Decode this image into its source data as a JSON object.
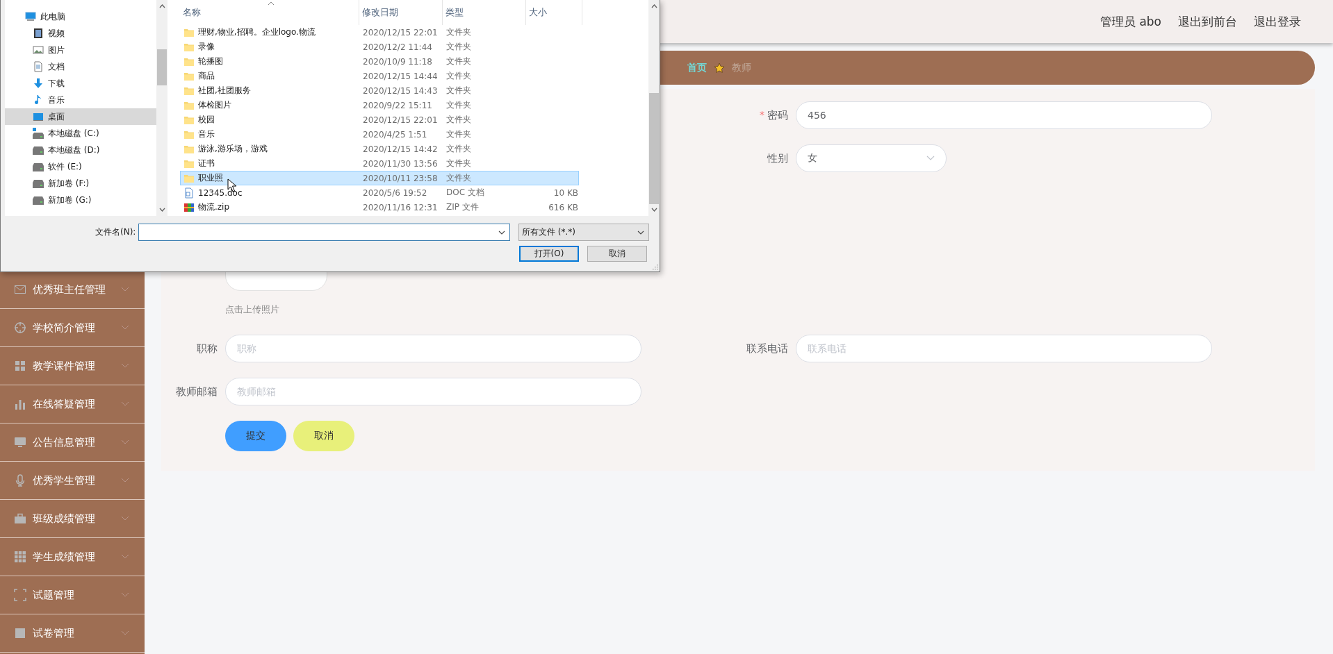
{
  "header": {
    "user": "管理员 abo",
    "links": [
      "退出到前台",
      "退出登录"
    ]
  },
  "sidebar": {
    "items": [
      {
        "label": "优秀班主任管理"
      },
      {
        "label": "学校简介管理"
      },
      {
        "label": "教学课件管理"
      },
      {
        "label": "在线答疑管理"
      },
      {
        "label": "公告信息管理"
      },
      {
        "label": "优秀学生管理"
      },
      {
        "label": "班级成绩管理"
      },
      {
        "label": "学生成绩管理"
      },
      {
        "label": "试题管理"
      },
      {
        "label": "试卷管理"
      }
    ]
  },
  "breadcrumb": [
    {
      "label": "首页",
      "current": false
    },
    {
      "label": "教师",
      "current": true
    }
  ],
  "form": {
    "rows": [
      {
        "right": {
          "kind": "text",
          "label": "密码",
          "required_mark": "*",
          "value": "456"
        }
      },
      {
        "right": {
          "kind": "select",
          "label": "性别",
          "value": "女"
        }
      },
      {
        "left": {
          "kind": "upload",
          "hint": "点击上传照片"
        }
      },
      {
        "left": {
          "kind": "text",
          "label": "职称",
          "placeholder": "职称"
        },
        "right": {
          "kind": "text",
          "label": "联系电话",
          "placeholder": "联系电话"
        }
      },
      {
        "left": {
          "kind": "text",
          "label": "教师邮箱",
          "placeholder": "教师邮箱"
        }
      }
    ],
    "buttons": [
      {
        "label": "提交",
        "kind": "primary"
      },
      {
        "label": "取消",
        "kind": "secondary"
      }
    ]
  },
  "file_dialog": {
    "nav": [
      {
        "label": "此电脑",
        "selected": false,
        "children": [
          {
            "label": "视频",
            "selected": false
          },
          {
            "label": "图片",
            "selected": false
          },
          {
            "label": "文档",
            "selected": false
          },
          {
            "label": "下载",
            "selected": false
          },
          {
            "label": "音乐",
            "selected": false
          },
          {
            "label": "桌面",
            "selected": true
          },
          {
            "label": "本地磁盘 (C:)",
            "selected": false
          },
          {
            "label": "本地磁盘 (D:)",
            "selected": false
          },
          {
            "label": "软件 (E:)",
            "selected": false
          },
          {
            "label": "新加卷 (F:)",
            "selected": false
          },
          {
            "label": "新加卷 (G:)",
            "selected": false
          }
        ]
      }
    ],
    "columns": [
      "名称",
      "修改日期",
      "类型",
      "大小"
    ],
    "files": [
      {
        "kind": "folder",
        "name": "理财,物业,招聘。企业logo.物流",
        "modified": "2020/12/15 22:01",
        "type": "文件夹",
        "selected": false
      },
      {
        "kind": "folder",
        "name": "录像",
        "modified": "2020/12/2 11:44",
        "type": "文件夹",
        "selected": false
      },
      {
        "kind": "folder",
        "name": "轮播图",
        "modified": "2020/10/9 11:18",
        "type": "文件夹",
        "selected": false
      },
      {
        "kind": "folder",
        "name": "商品",
        "modified": "2020/12/15 14:44",
        "type": "文件夹",
        "selected": false
      },
      {
        "kind": "folder",
        "name": "社团,社团服务",
        "modified": "2020/12/15 14:43",
        "type": "文件夹",
        "selected": false
      },
      {
        "kind": "folder",
        "name": "体检图片",
        "modified": "2020/9/22 15:11",
        "type": "文件夹",
        "selected": false
      },
      {
        "kind": "folder",
        "name": "校园",
        "modified": "2020/12/15 22:01",
        "type": "文件夹",
        "selected": false
      },
      {
        "kind": "folder",
        "name": "音乐",
        "modified": "2020/4/25 1:51",
        "type": "文件夹",
        "selected": false
      },
      {
        "kind": "folder",
        "name": "游泳,游乐场，游戏",
        "modified": "2020/12/15 14:42",
        "type": "文件夹",
        "selected": false
      },
      {
        "kind": "folder",
        "name": "证书",
        "modified": "2020/11/30 13:56",
        "type": "文件夹",
        "selected": false
      },
      {
        "kind": "folder",
        "name": "职业照",
        "modified": "2020/10/11 23:58",
        "type": "文件夹",
        "selected": true
      },
      {
        "kind": "doc",
        "name": "12345.doc",
        "modified": "2020/5/6 19:52",
        "type": "DOC 文档",
        "size": "10 KB",
        "selected": false
      },
      {
        "kind": "zip",
        "name": "物流.zip",
        "modified": "2020/11/16 12:31",
        "type": "ZIP 文件",
        "size": "616 KB",
        "selected": false
      }
    ],
    "filename_label": "文件名(N):",
    "filter": "所有文件 (*.*)",
    "buttons": [
      {
        "label": "打开(O)",
        "default": true
      },
      {
        "label": "取消",
        "default": false
      }
    ]
  }
}
